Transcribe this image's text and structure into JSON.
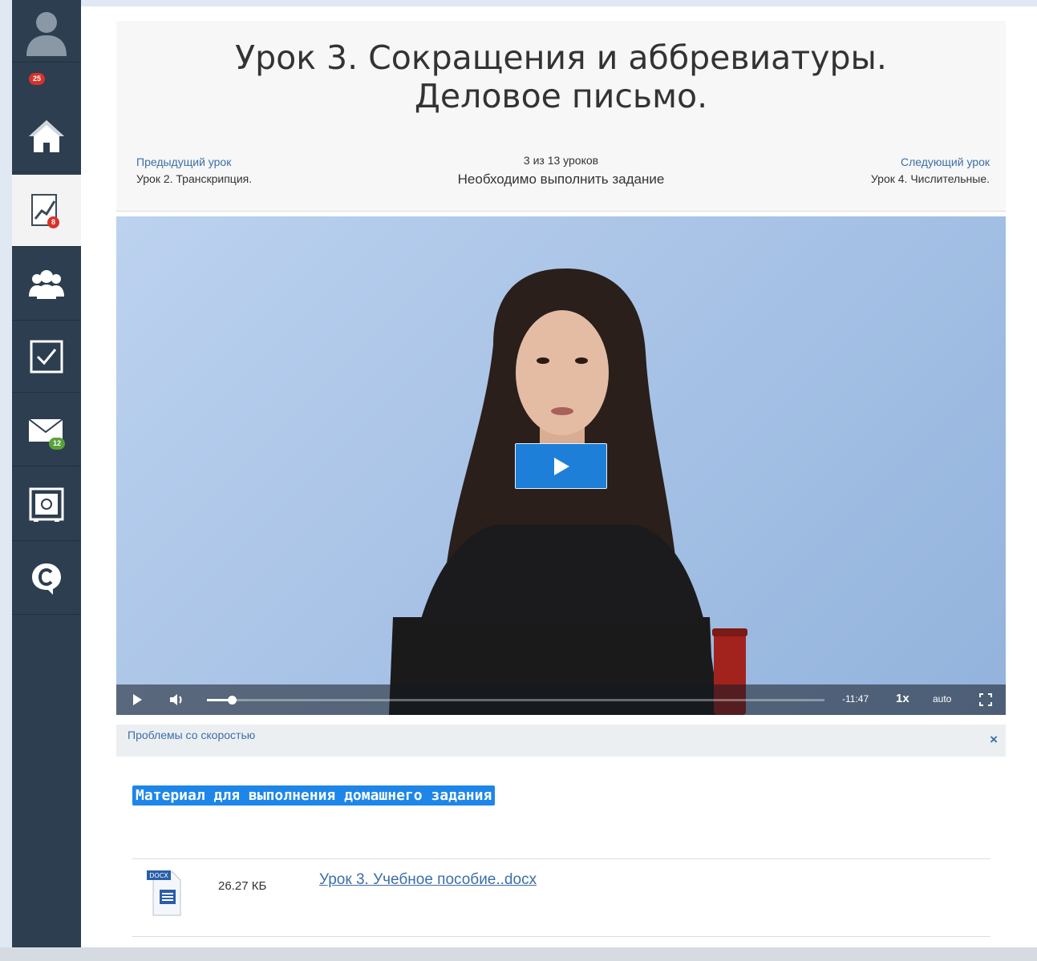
{
  "sidebar": {
    "profile_badge": "25",
    "progress_badge": "8",
    "messages_badge": "12"
  },
  "lesson": {
    "title": "Урок 3. Сокращения и аббревиатуры. Деловое письмо.",
    "prev_label": "Предыдущий урок",
    "prev_value": "Урок 2. Транскрипция.",
    "counter": "3 из 13 уроков",
    "task_status": "Необходимо выполнить задание",
    "next_label": "Следующий урок",
    "next_value": "Урок 4. Числительные."
  },
  "video": {
    "time_remaining": "-11:47",
    "speed": "1x",
    "quality": "auto",
    "progress": 0.04
  },
  "speed_bar": {
    "text": "Проблемы со скоростью",
    "close": "×"
  },
  "homework": {
    "title": "Материал для выполнения домашнего задания",
    "file": {
      "type_label": "DOCX",
      "size": "26.27 КБ",
      "name": "Урок 3. Учебное пособие..docx"
    }
  },
  "colors": {
    "sidebar": "#2c3e50",
    "accent": "#1e86e8",
    "link": "#3c6ea8",
    "badge_red": "#d9322b",
    "badge_green": "#5aa13a"
  }
}
